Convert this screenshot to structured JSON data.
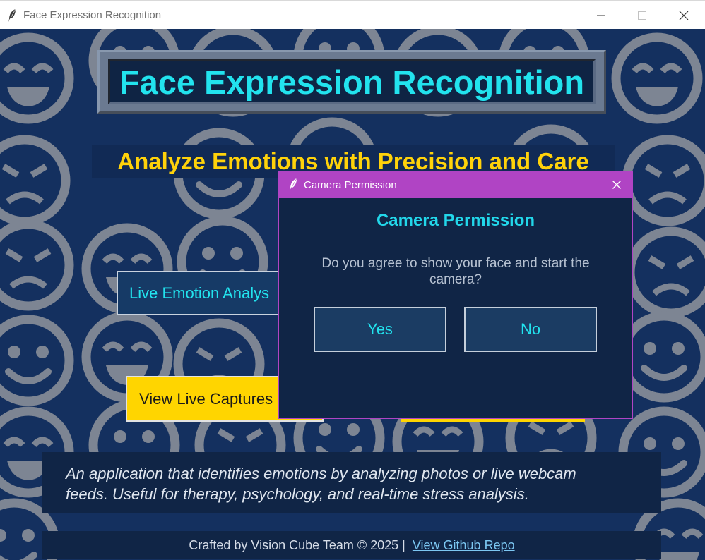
{
  "window": {
    "title": "Face Expression Recognition",
    "controls": [
      "minimize",
      "maximize",
      "close"
    ]
  },
  "header": {
    "title": "Face Expression Recognition",
    "subtitle": "Analyze Emotions with Precision and Care"
  },
  "buttons": {
    "live_emotion": "Live Emotion Analys",
    "view_captures": "View Live Captures"
  },
  "description": {
    "line1": "An application that identifies emotions by analyzing photos or live webcam",
    "line2": "feeds. Useful for therapy, psychology, and real-time stress analysis."
  },
  "footer": {
    "credit": "Crafted by Vision Cube Team © 2025 |",
    "link": "View Github Repo"
  },
  "dialog": {
    "window_title": "Camera Permission",
    "heading": "Camera Permission",
    "message": "Do you agree to show your face and start the camera?",
    "yes_label": "Yes",
    "no_label": "No"
  },
  "colors": {
    "background": "#14305f",
    "accent_cyan": "#22e3ee",
    "accent_yellow": "#ffd500",
    "dialog_titlebar": "#b044c4"
  },
  "icons": {
    "app": "feather-icon",
    "pattern": "emoji-face-icon"
  }
}
